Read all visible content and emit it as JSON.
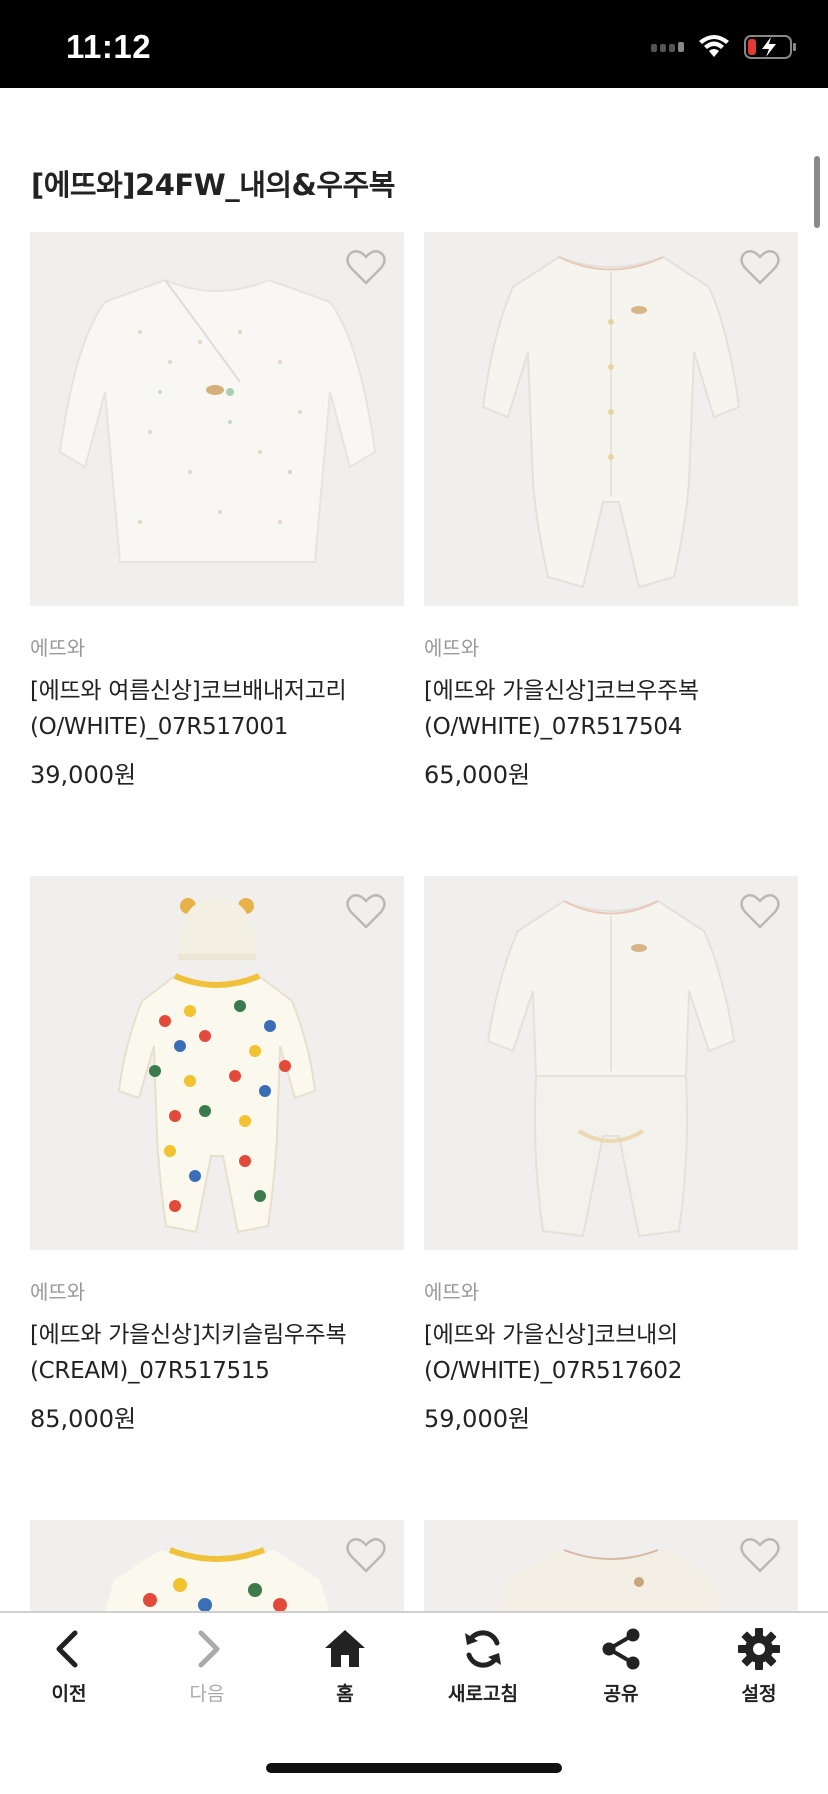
{
  "status_bar": {
    "time": "11:12"
  },
  "page": {
    "title": "[에뜨와]24FW_내의&우주복"
  },
  "products": [
    {
      "brand": "에뜨와",
      "name_line1": "[에뜨와 여름신상]코브배내저고리",
      "name_line2": "(O/WHITE)_07R517001",
      "price": "39,000원"
    },
    {
      "brand": "에뜨와",
      "name_line1": "[에뜨와 가을신상]코브우주복",
      "name_line2": "(O/WHITE)_07R517504",
      "price": "65,000원"
    },
    {
      "brand": "에뜨와",
      "name_line1": "[에뜨와 가을신상]치키슬림우주복",
      "name_line2": "(CREAM)_07R517515",
      "price": "85,000원"
    },
    {
      "brand": "에뜨와",
      "name_line1": "[에뜨와 가을신상]코브내의",
      "name_line2": "(O/WHITE)_07R517602",
      "price": "59,000원"
    }
  ],
  "bottom_nav": {
    "prev": "이전",
    "next": "다음",
    "home": "홈",
    "refresh": "새로고침",
    "share": "공유",
    "settings": "설정"
  },
  "icons": [
    "heart-outline-icon",
    "chevron-left-icon",
    "chevron-right-icon",
    "home-icon",
    "refresh-icon",
    "share-icon",
    "gear-icon"
  ]
}
